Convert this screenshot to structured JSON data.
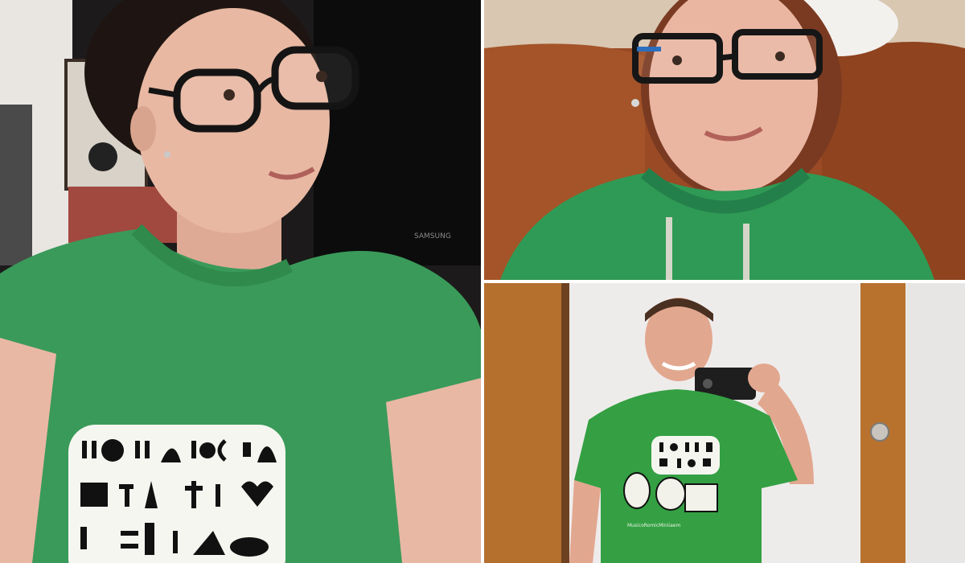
{
  "collage": {
    "photos": [
      {
        "id_name": "photo-woman-tshirt",
        "subject": "woman with glasses in green t-shirt",
        "tv_brand_text": "SAMSUNG",
        "shirt": {
          "color": "#3a9a5a",
          "print": "speech bubble with pictograph glyphs"
        }
      },
      {
        "id_name": "photo-woman-hoodie",
        "subject": "woman with glasses in green hoodie on brown couch",
        "shirt": {
          "color": "#2f9a55"
        },
        "couch_color": "#9a4a24"
      },
      {
        "id_name": "photo-man-mirror",
        "subject": "man taking mirror selfie in green t-shirt",
        "shirt": {
          "color": "#34a043",
          "caption_text": "MusicoRomicMiniiaem"
        },
        "door_color": "#b8722e"
      }
    ]
  },
  "colors": {
    "gutter": "#ffffff",
    "shirt_green": "#38a050",
    "wall": "#eeeceb",
    "wood": "#b5702e",
    "skin": "#e6b39e"
  }
}
